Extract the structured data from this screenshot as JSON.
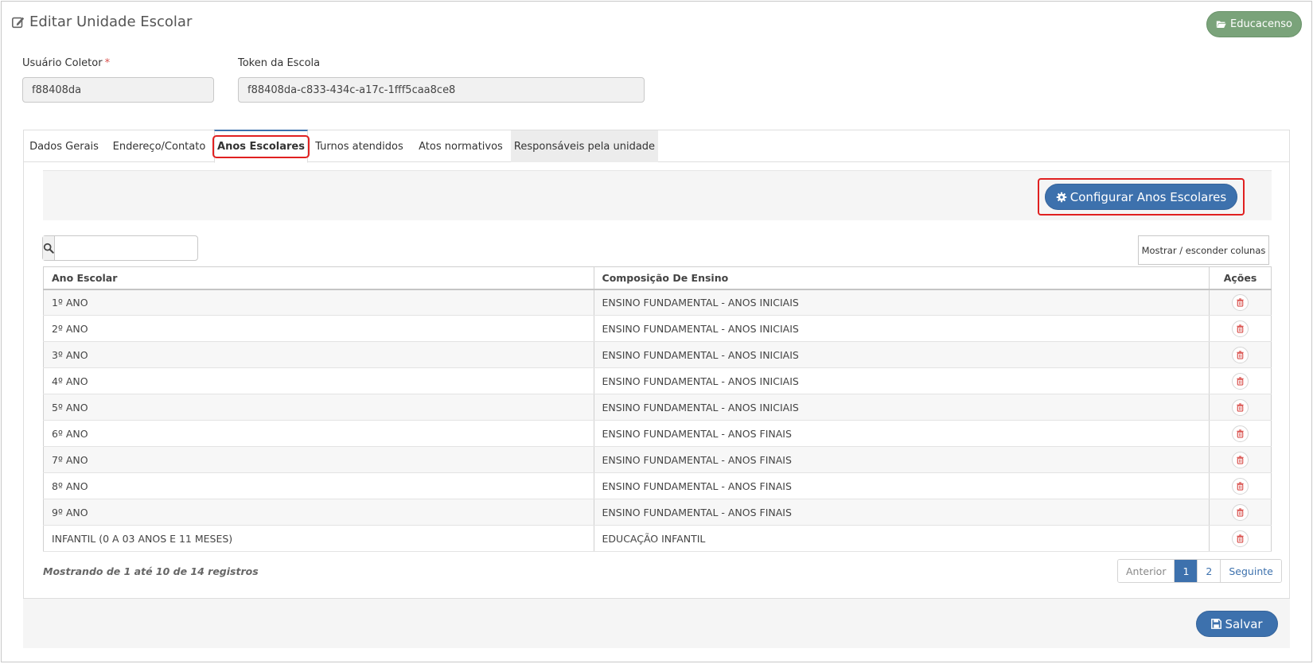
{
  "header": {
    "title": "Editar Unidade Escolar",
    "educacenso_label": "Educacenso"
  },
  "fields": {
    "usuario_coletor": {
      "label": "Usuário Coletor",
      "required_mark": "*",
      "value": "f88408da"
    },
    "token_escola": {
      "label": "Token da Escola",
      "value": "f88408da-c833-434c-a17c-1fff5caa8ce8"
    }
  },
  "tabs": [
    {
      "label": "Dados Gerais"
    },
    {
      "label": "Endereço/Contato"
    },
    {
      "label": "Anos Escolares"
    },
    {
      "label": "Turnos atendidos"
    },
    {
      "label": "Atos normativos"
    },
    {
      "label": "Responsáveis pela unidade"
    }
  ],
  "active_tab": "Anos Escolares",
  "toolbar": {
    "configurar_label": "Configurar Anos Escolares",
    "search_placeholder": "",
    "toggle_columns_label": "Mostrar / esconder colunas"
  },
  "table": {
    "columns": [
      "Ano Escolar",
      "Composição De Ensino",
      "Ações"
    ],
    "rows": [
      {
        "ano": "1º ANO",
        "composicao": "ENSINO FUNDAMENTAL - ANOS INICIAIS"
      },
      {
        "ano": "2º ANO",
        "composicao": "ENSINO FUNDAMENTAL - ANOS INICIAIS"
      },
      {
        "ano": "3º ANO",
        "composicao": "ENSINO FUNDAMENTAL - ANOS INICIAIS"
      },
      {
        "ano": "4º ANO",
        "composicao": "ENSINO FUNDAMENTAL - ANOS INICIAIS"
      },
      {
        "ano": "5º ANO",
        "composicao": "ENSINO FUNDAMENTAL - ANOS INICIAIS"
      },
      {
        "ano": "6º ANO",
        "composicao": "ENSINO FUNDAMENTAL - ANOS FINAIS"
      },
      {
        "ano": "7º ANO",
        "composicao": "ENSINO FUNDAMENTAL - ANOS FINAIS"
      },
      {
        "ano": "8º ANO",
        "composicao": "ENSINO FUNDAMENTAL - ANOS FINAIS"
      },
      {
        "ano": "9º ANO",
        "composicao": "ENSINO FUNDAMENTAL - ANOS FINAIS"
      },
      {
        "ano": "INFANTIL (0 A 03 ANOS E 11 MESES)",
        "composicao": "EDUCAÇÃO INFANTIL"
      }
    ]
  },
  "pagination": {
    "info": "Mostrando de 1 até 10 de 14 registros",
    "prev_label": "Anterior",
    "pages": [
      "1",
      "2"
    ],
    "current_page": "1",
    "next_label": "Seguinte"
  },
  "footer": {
    "save_label": "Salvar"
  },
  "icons": {
    "title": "edit-icon",
    "educacenso": "folder-open-icon",
    "configurar": "gear-icon",
    "search": "search-icon",
    "delete": "trash-icon",
    "save": "floppy-disk-icon"
  },
  "colors": {
    "primary": "#3d71ad",
    "educacenso": "#7aa37a",
    "highlight": "#e02020",
    "danger": "#d9534f"
  }
}
